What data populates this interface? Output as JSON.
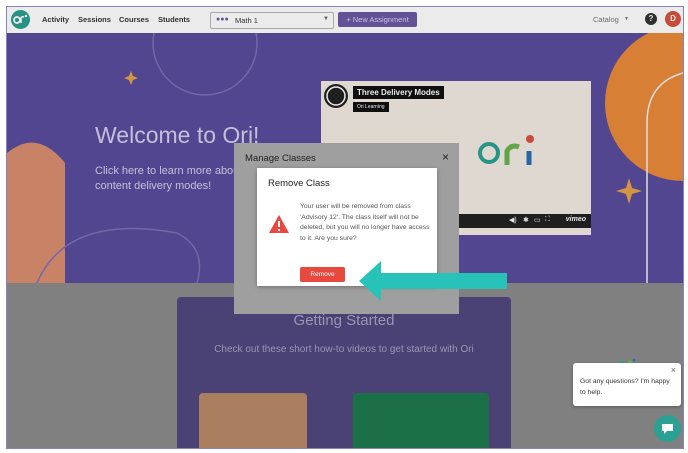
{
  "nav": {
    "links": [
      "Activity",
      "Sessions",
      "Courses",
      "Students"
    ],
    "class_select": "Math 1",
    "new_assignment": "+  New Assignment",
    "catalog": "Catalog",
    "help": "?",
    "avatar_initial": "D"
  },
  "hero": {
    "title": "Welcome to Ori!",
    "subtitle": "Click here to learn more about content delivery modes!",
    "video": {
      "title": "Three Delivery Modes",
      "badge": "Ori Learning",
      "player": "vimeo"
    }
  },
  "getting_started": {
    "title": "Getting Started",
    "subtitle": "Check out these short how-to videos to get started with Ori"
  },
  "manage_classes": {
    "title": "Manage Classes",
    "close": "×"
  },
  "remove_class": {
    "title": "Remove Class",
    "message": "Your user will be removed from class 'Advisory 12'. The class itself will not be deleted, but you will no longer have access to it. Are you sure?",
    "confirm": "Remove"
  },
  "chat": {
    "message": "Got any questions? I'm happy to help.",
    "close": "×"
  },
  "colors": {
    "brand_purple": "#5a4d9e",
    "teal": "#2aa192",
    "danger": "#e8493e",
    "arrow": "#27c3b8"
  },
  "icons": {
    "warning": "warning-icon",
    "chat": "chat-icon"
  }
}
